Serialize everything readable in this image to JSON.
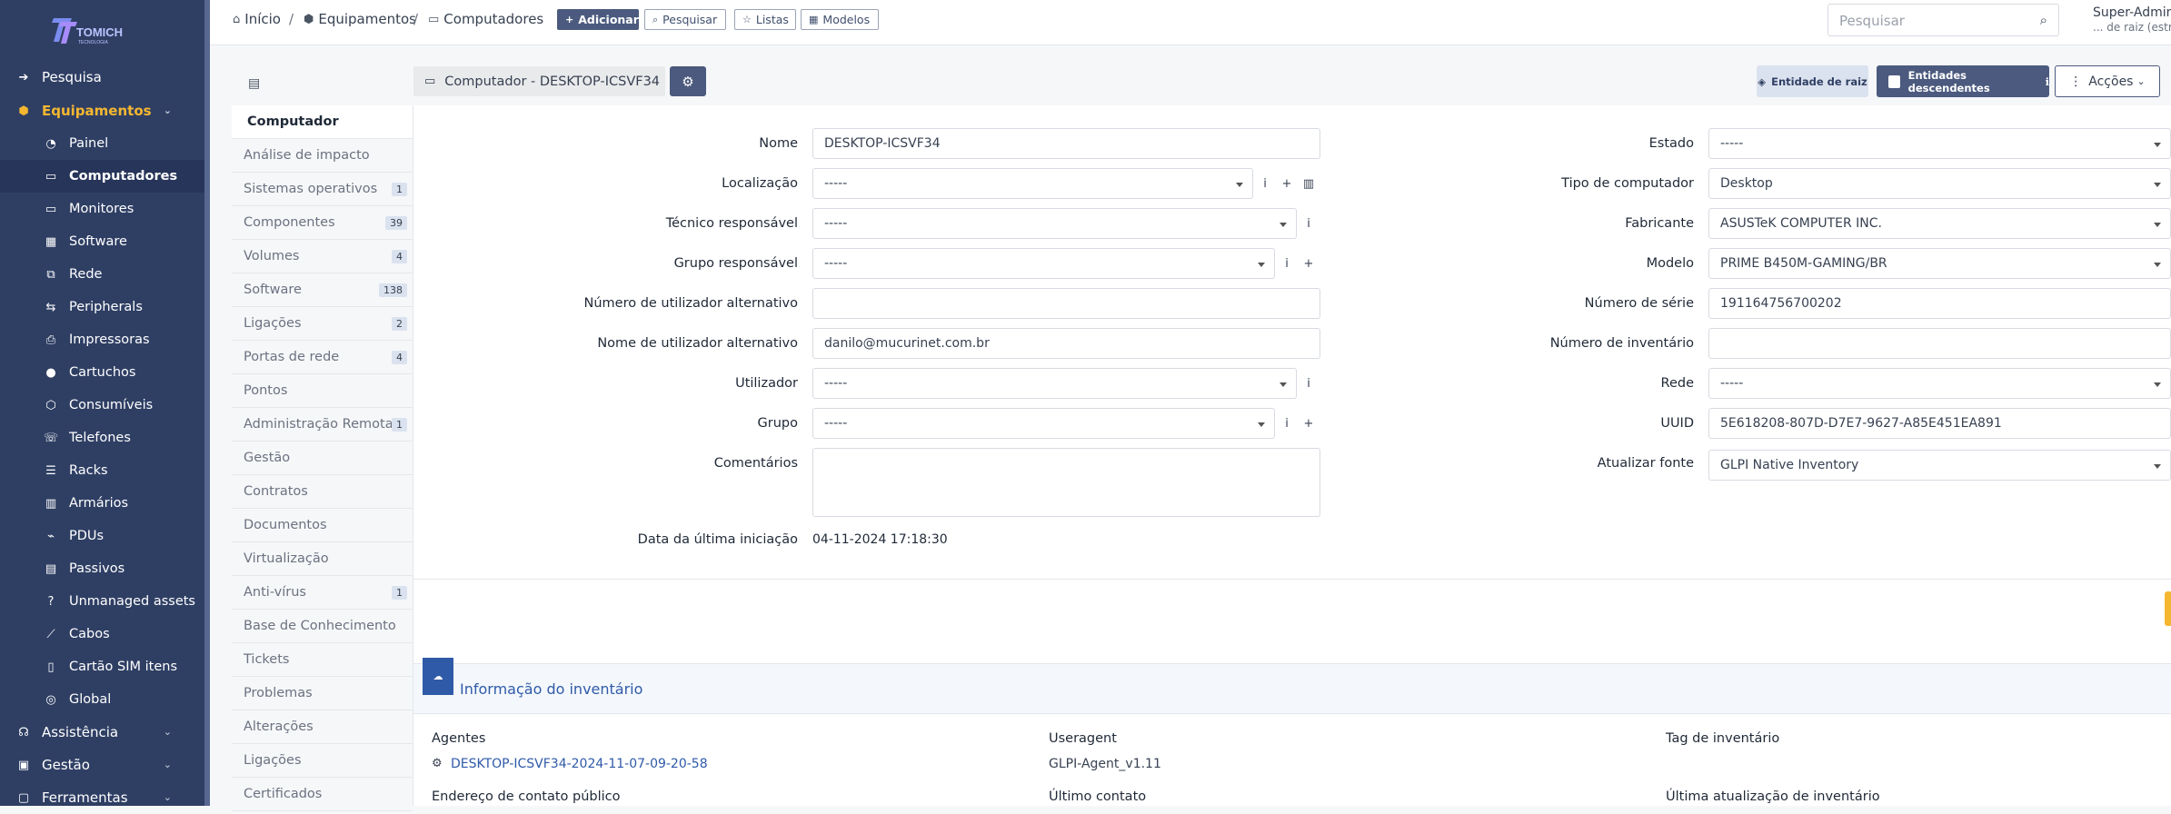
{
  "brand": {
    "logo_text": "TOMICH",
    "logo_sub": "TECNOLOGIA",
    "accent": "#f5b730",
    "nav_bg": "#2f3f64"
  },
  "sidebar": {
    "items": [
      {
        "label": "Pesquisa",
        "icon": "arrow-right-to-bracket-icon"
      },
      {
        "label": "Equipamentos",
        "icon": "box-icon"
      },
      {
        "label": "Painel",
        "icon": "dashboard-icon"
      },
      {
        "label": "Computadores",
        "icon": "laptop-icon"
      },
      {
        "label": "Monitores",
        "icon": "monitor-icon"
      },
      {
        "label": "Software",
        "icon": "apps-icon"
      },
      {
        "label": "Rede",
        "icon": "network-icon"
      },
      {
        "label": "Peripherals",
        "icon": "usb-icon"
      },
      {
        "label": "Impressoras",
        "icon": "printer-icon"
      },
      {
        "label": "Cartuchos",
        "icon": "droplet-icon"
      },
      {
        "label": "Consumíveis",
        "icon": "package-icon"
      },
      {
        "label": "Telefones",
        "icon": "phone-icon"
      },
      {
        "label": "Racks",
        "icon": "server-icon"
      },
      {
        "label": "Armários",
        "icon": "columns-icon"
      },
      {
        "label": "PDUs",
        "icon": "plug-icon"
      },
      {
        "label": "Passivos",
        "icon": "cable-icon"
      },
      {
        "label": "Unmanaged assets",
        "icon": "question-icon"
      },
      {
        "label": "Cabos",
        "icon": "line-icon"
      },
      {
        "label": "Cartão SIM itens",
        "icon": "sim-icon"
      },
      {
        "label": "Global",
        "icon": "globe-icon"
      },
      {
        "label": "Assistência",
        "icon": "headset-icon"
      },
      {
        "label": "Gestão",
        "icon": "wallet-icon"
      },
      {
        "label": "Ferramentas",
        "icon": "briefcase-icon"
      }
    ]
  },
  "breadcrumb": {
    "home": "Início",
    "section": "Equipamentos",
    "page": "Computadores"
  },
  "toolbar": {
    "add": "Adicionar",
    "search": "Pesquisar",
    "lists": "Listas",
    "templates": "Modelos"
  },
  "search": {
    "placeholder": "Pesquisar"
  },
  "user": {
    "name": "Super-Admin",
    "entity": "... de raiz (estru"
  },
  "item": {
    "title": "Computador - DESKTOP-ICSVF34"
  },
  "header_buttons": {
    "root_entity": "Entidade de raiz",
    "child_entities": "Entidades descendentes",
    "actions": "Acções"
  },
  "tabs": [
    {
      "label": "Computador",
      "count": ""
    },
    {
      "label": "Análise de impacto",
      "count": ""
    },
    {
      "label": "Sistemas operativos",
      "count": "1"
    },
    {
      "label": "Componentes",
      "count": "39"
    },
    {
      "label": "Volumes",
      "count": "4"
    },
    {
      "label": "Software",
      "count": "138"
    },
    {
      "label": "Ligações",
      "count": "2"
    },
    {
      "label": "Portas de rede",
      "count": "4"
    },
    {
      "label": "Pontos",
      "count": ""
    },
    {
      "label": "Administração Remota",
      "count": "1"
    },
    {
      "label": "Gestão",
      "count": ""
    },
    {
      "label": "Contratos",
      "count": ""
    },
    {
      "label": "Documentos",
      "count": ""
    },
    {
      "label": "Virtualização",
      "count": ""
    },
    {
      "label": "Anti-vírus",
      "count": "1"
    },
    {
      "label": "Base de Conhecimento",
      "count": ""
    },
    {
      "label": "Tickets",
      "count": ""
    },
    {
      "label": "Problemas",
      "count": ""
    },
    {
      "label": "Alterações",
      "count": ""
    },
    {
      "label": "Ligações",
      "count": ""
    },
    {
      "label": "Certificados",
      "count": ""
    }
  ],
  "form": {
    "name": {
      "label": "Nome",
      "value": "DESKTOP-ICSVF34"
    },
    "location": {
      "label": "Localização",
      "value": "-----"
    },
    "tech": {
      "label": "Técnico responsável",
      "value": "-----"
    },
    "tech_group": {
      "label": "Grupo responsável",
      "value": "-----"
    },
    "alt_user_num": {
      "label": "Número de utilizador alternativo",
      "value": ""
    },
    "alt_user_name": {
      "label": "Nome de utilizador alternativo",
      "value": "danilo@mucurinet.com.br"
    },
    "user": {
      "label": "Utilizador",
      "value": "-----"
    },
    "group": {
      "label": "Grupo",
      "value": "-----"
    },
    "comments": {
      "label": "Comentários",
      "value": ""
    },
    "last_boot": {
      "label": "Data da última iniciação",
      "value": "04-11-2024 17:18:30"
    },
    "status": {
      "label": "Estado",
      "value": "-----"
    },
    "type": {
      "label": "Tipo de computador",
      "value": "Desktop"
    },
    "manufacturer": {
      "label": "Fabricante",
      "value": "ASUSTeK COMPUTER INC."
    },
    "model": {
      "label": "Modelo",
      "value": "PRIME B450M-GAMING/BR"
    },
    "serial": {
      "label": "Número de série",
      "value": "191164756700202"
    },
    "inventory": {
      "label": "Número de inventário",
      "value": ""
    },
    "network": {
      "label": "Rede",
      "value": "-----"
    },
    "uuid": {
      "label": "UUID",
      "value": "5E618208-807D-D7E7-9627-A85E451EA891"
    },
    "source": {
      "label": "Atualizar fonte",
      "value": "GLPI Native Inventory"
    }
  },
  "inventory": {
    "title": "Informação do inventário",
    "agents_label": "Agentes",
    "agent_link": "DESKTOP-ICSVF34-2024-11-07-09-20-58",
    "useragent_label": "Useragent",
    "useragent_value": "GLPI-Agent_v1.11",
    "tag_label": "Tag de inventário",
    "public_contact_label": "Endereço de contato público",
    "last_contact_label": "Último contato",
    "last_update_label": "Última atualização de inventário"
  }
}
